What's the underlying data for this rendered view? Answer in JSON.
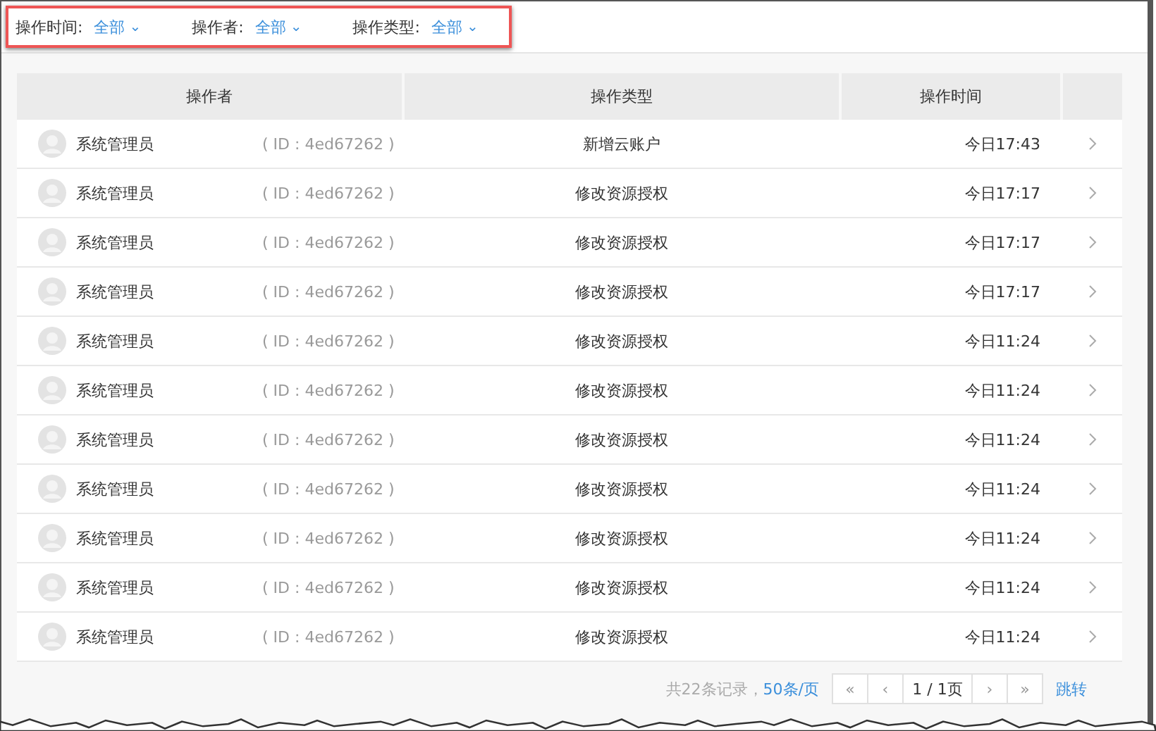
{
  "filters": [
    {
      "label": "操作时间:",
      "value": "全部",
      "caret": "⌄"
    },
    {
      "label": "操作者:",
      "value": "全部",
      "caret": "⌄"
    },
    {
      "label": "操作类型:",
      "value": "全部",
      "caret": "⌄"
    }
  ],
  "table": {
    "columns": [
      "操作者",
      "操作类型",
      "操作时间"
    ],
    "rows": [
      {
        "operator": "系统管理员",
        "id": "( ID : 4ed67262 )",
        "type": "新增云账户",
        "time": "今日17:43"
      },
      {
        "operator": "系统管理员",
        "id": "( ID : 4ed67262 )",
        "type": "修改资源授权",
        "time": "今日17:17"
      },
      {
        "operator": "系统管理员",
        "id": "( ID : 4ed67262 )",
        "type": "修改资源授权",
        "time": "今日17:17"
      },
      {
        "operator": "系统管理员",
        "id": "( ID : 4ed67262 )",
        "type": "修改资源授权",
        "time": "今日17:17"
      },
      {
        "operator": "系统管理员",
        "id": "( ID : 4ed67262 )",
        "type": "修改资源授权",
        "time": "今日11:24"
      },
      {
        "operator": "系统管理员",
        "id": "( ID : 4ed67262 )",
        "type": "修改资源授权",
        "time": "今日11:24"
      },
      {
        "operator": "系统管理员",
        "id": "( ID : 4ed67262 )",
        "type": "修改资源授权",
        "time": "今日11:24"
      },
      {
        "operator": "系统管理员",
        "id": "( ID : 4ed67262 )",
        "type": "修改资源授权",
        "time": "今日11:24"
      },
      {
        "operator": "系统管理员",
        "id": "( ID : 4ed67262 )",
        "type": "修改资源授权",
        "time": "今日11:24"
      },
      {
        "operator": "系统管理员",
        "id": "( ID : 4ed67262 )",
        "type": "修改资源授权",
        "time": "今日11:24"
      },
      {
        "operator": "系统管理员",
        "id": "( ID : 4ed67262 )",
        "type": "修改资源授权",
        "time": "今日11:24"
      }
    ]
  },
  "pagination": {
    "total": "共22条记录，",
    "page_size": "50条/页",
    "first": "«",
    "prev": "‹",
    "page": "1 / 1页",
    "next": "›",
    "last": "»",
    "jump": "跳转"
  }
}
